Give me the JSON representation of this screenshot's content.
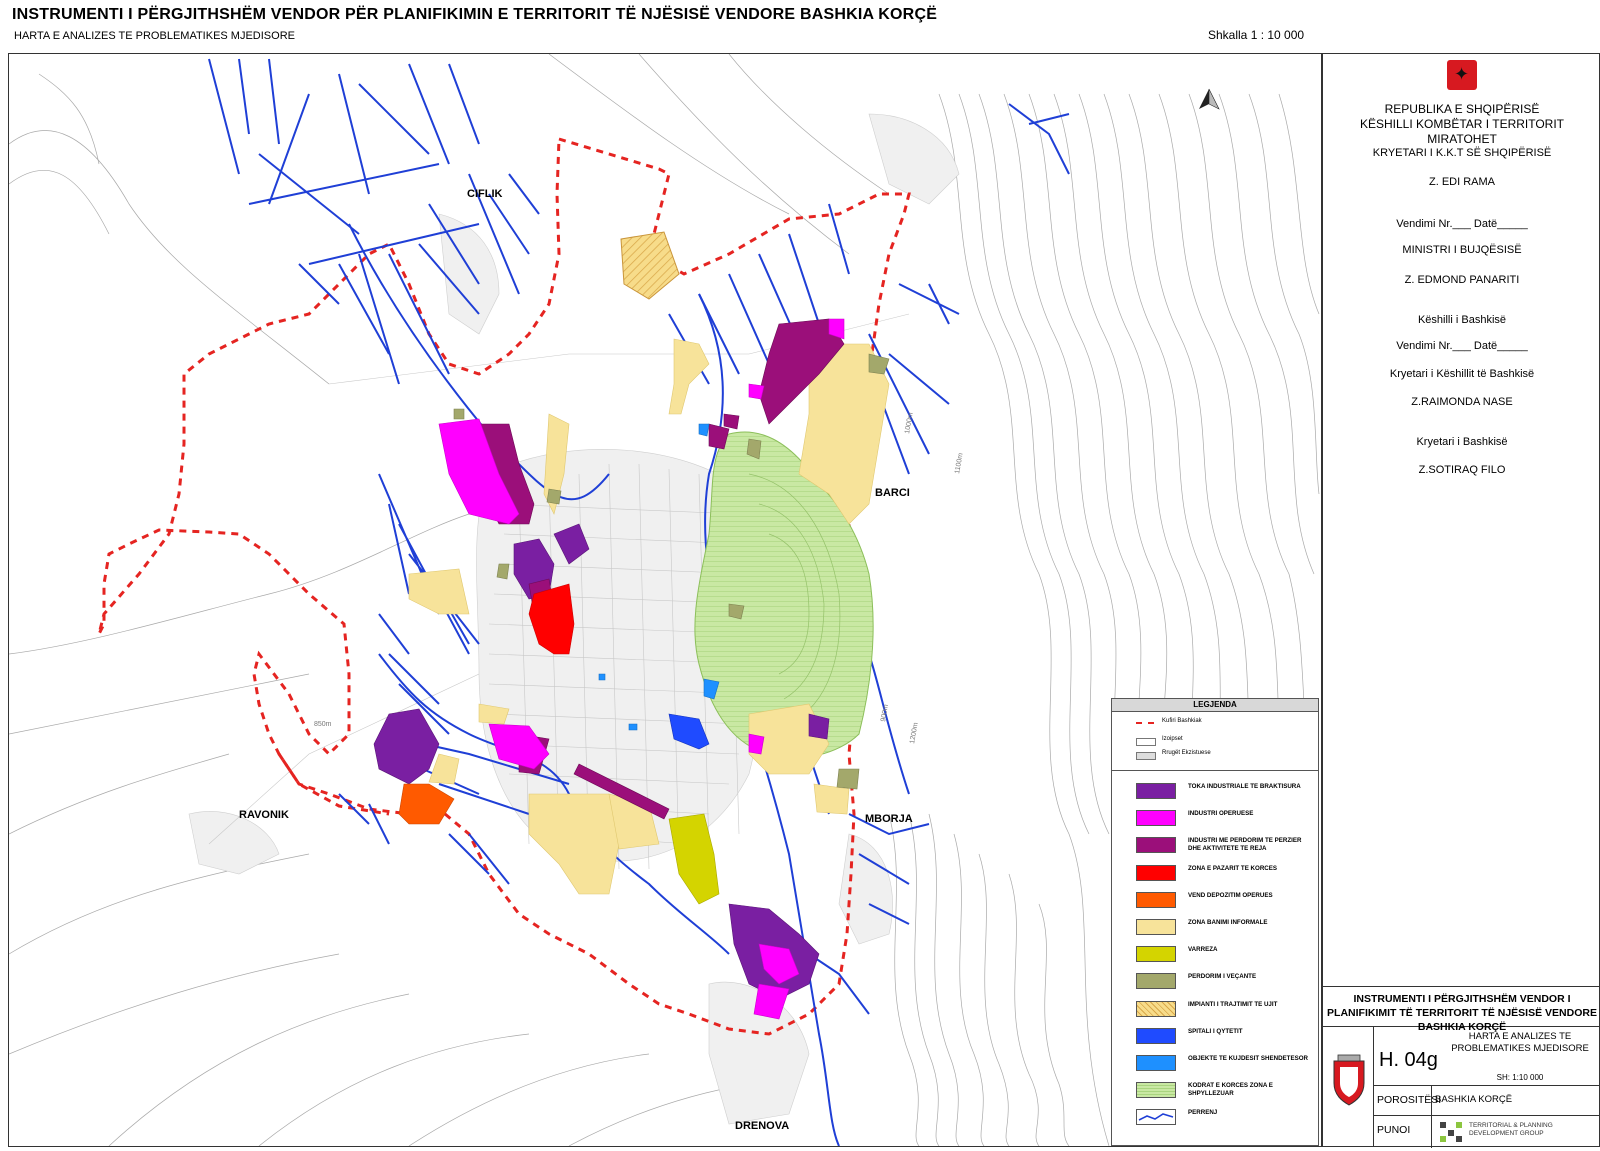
{
  "header": {
    "title": "INSTRUMENTI I PËRGJITHSHËM VENDOR PËR PLANIFIKIMIN E TERRITORIT TË NJËSISË VENDORE BASHKIA KORÇË",
    "subtitle": "HARTA E ANALIZES TE PROBLEMATIKES MJEDISORE",
    "scale": "Shkalla 1 : 10 000"
  },
  "places": {
    "ciflik": "CIFLIK",
    "barci": "BARCI",
    "ravonik": "RAVONIK",
    "mborja": "MBORJA",
    "drenova": "DRENOVA"
  },
  "contour_labels": [
    "850m",
    "900m",
    "1000m",
    "1100m",
    "1200m"
  ],
  "approvals": {
    "line1": "REPUBLIKA E SHQIPËRISË",
    "line2": "KËSHILLI KOMBËTAR I TERRITORIT",
    "line3": "MIRATOHET",
    "line4": "KRYETARI I K.K.T SË SHQIPËRISË",
    "line5": "Z. EDI RAMA",
    "line6": "Vendimi Nr.___ Datë_____",
    "line7": "MINISTRI I BUJQËSISË",
    "line8": "Z. EDMOND PANARITI",
    "line9": "Këshilli i Bashkisë",
    "line10": "Vendimi Nr.___ Datë_____",
    "line11": "Kryetari i Këshillit të Bashkisë",
    "line12": "Z.RAIMONDA NASE",
    "line13": "Kryetari i Bashkisë",
    "line14": "Z.SOTIRAQ FILO"
  },
  "titleblock": {
    "head": "INSTRUMENTI I PËRGJITHSHËM VENDOR I PLANIFIKIMIT TË TERRITORIT TË NJËSISË VENDORE BASHKIA KORÇË",
    "map_number": "H. 04g",
    "map_name": "HARTA E ANALIZES TE PROBLEMATIKES MJEDISORE",
    "sheet_scale": "SH: 1:10 000",
    "client_label": "POROSITËSI",
    "client": "BASHKIA KORÇË",
    "author_label": "PUNOI",
    "author": "TERRITORIAL & PLANNING DEVELOPMENT GROUP"
  },
  "legend": {
    "title": "LEGJENDA",
    "top_items": [
      {
        "label": "Kufiri Bashkiak",
        "style": "dash",
        "color": "#e52421"
      },
      {
        "label": "Izoipset",
        "style": "box",
        "color": "#ffffff"
      },
      {
        "label": "Rrugët Ekzistuese",
        "style": "box",
        "color": "#dddddd"
      }
    ],
    "items": [
      {
        "label": "TOKA INDUSTRIALE TE BRAKTISURA",
        "color": "#7a1fa2"
      },
      {
        "label": "INDUSTRI OPERUESE",
        "color": "#ff00ff"
      },
      {
        "label": "INDUSTRI ME PERDORIM TE PERZIER DHE AKTIVITETE TE REJA",
        "color": "#9b0f7a"
      },
      {
        "label": "ZONA E PAZARIT TE KORCES",
        "color": "#ff0000"
      },
      {
        "label": "VEND DEPOZITIM OPERUES",
        "color": "#ff5a00"
      },
      {
        "label": "ZONA BANIMI INFORMALE",
        "color": "#f7e39a"
      },
      {
        "label": "VARREZA",
        "color": "#d4d400"
      },
      {
        "label": "PERDORIM I VEÇANTE",
        "color": "#a3a86b"
      },
      {
        "label": "IMPIANTI I TRAJTIMIT TE UJIT",
        "color": "#f2d27a"
      },
      {
        "label": "SPITALI I QYTETIT",
        "color": "#1f4bff"
      },
      {
        "label": "OBJEKTE TE KUJDESIT SHENDETESOR",
        "color": "#1e90ff"
      },
      {
        "label": "KODRAT E KORCES ZONA E SHPYLLEZUAR",
        "color": "#c8e6a0"
      },
      {
        "label": "PERRENJ",
        "color": "#1f3fd6"
      }
    ]
  }
}
